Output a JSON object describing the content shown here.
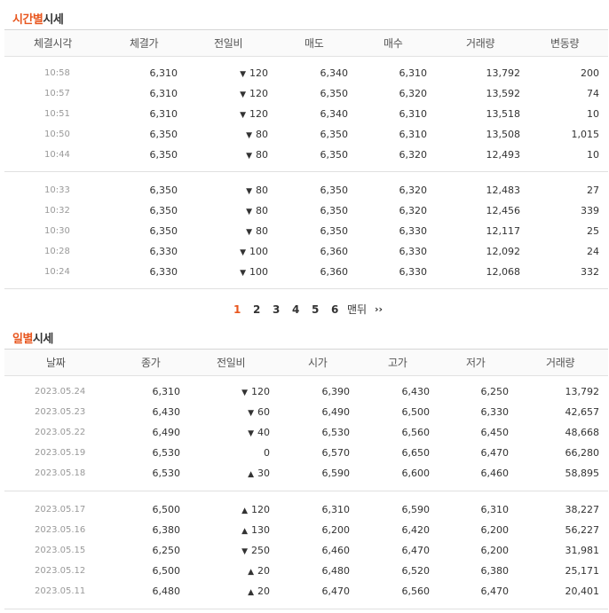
{
  "intraday": {
    "title_highlight": "시간별",
    "title_rest": "시세",
    "headers": [
      "체결시각",
      "체결가",
      "전일비",
      "매도",
      "매수",
      "거래량",
      "변동량"
    ],
    "rows": [
      {
        "time": "10:58",
        "price": "6,310",
        "dir": "down",
        "change": "120",
        "ask": "6,340",
        "bid": "6,310",
        "volume": "13,792",
        "delta": "200"
      },
      {
        "time": "10:57",
        "price": "6,310",
        "dir": "down",
        "change": "120",
        "ask": "6,350",
        "bid": "6,320",
        "volume": "13,592",
        "delta": "74"
      },
      {
        "time": "10:51",
        "price": "6,310",
        "dir": "down",
        "change": "120",
        "ask": "6,340",
        "bid": "6,310",
        "volume": "13,518",
        "delta": "10"
      },
      {
        "time": "10:50",
        "price": "6,350",
        "dir": "down",
        "change": "80",
        "ask": "6,350",
        "bid": "6,310",
        "volume": "13,508",
        "delta": "1,015"
      },
      {
        "time": "10:44",
        "price": "6,350",
        "dir": "down",
        "change": "80",
        "ask": "6,350",
        "bid": "6,320",
        "volume": "12,493",
        "delta": "10"
      },
      {
        "time": "10:33",
        "price": "6,350",
        "dir": "down",
        "change": "80",
        "ask": "6,350",
        "bid": "6,320",
        "volume": "12,483",
        "delta": "27"
      },
      {
        "time": "10:32",
        "price": "6,350",
        "dir": "down",
        "change": "80",
        "ask": "6,350",
        "bid": "6,320",
        "volume": "12,456",
        "delta": "339"
      },
      {
        "time": "10:30",
        "price": "6,350",
        "dir": "down",
        "change": "80",
        "ask": "6,350",
        "bid": "6,330",
        "volume": "12,117",
        "delta": "25"
      },
      {
        "time": "10:28",
        "price": "6,330",
        "dir": "down",
        "change": "100",
        "ask": "6,360",
        "bid": "6,330",
        "volume": "12,092",
        "delta": "24"
      },
      {
        "time": "10:24",
        "price": "6,330",
        "dir": "down",
        "change": "100",
        "ask": "6,360",
        "bid": "6,330",
        "volume": "12,068",
        "delta": "332"
      }
    ]
  },
  "pagination": {
    "pages": [
      "1",
      "2",
      "3",
      "4",
      "5",
      "6"
    ],
    "current": "1",
    "last_label": "맨뒤",
    "next_label": "››"
  },
  "daily": {
    "title_highlight": "일별",
    "title_rest": "시세",
    "headers": [
      "날짜",
      "종가",
      "전일비",
      "시가",
      "고가",
      "저가",
      "거래량"
    ],
    "rows": [
      {
        "date": "2023.05.24",
        "close": "6,310",
        "dir": "down",
        "change": "120",
        "open": "6,390",
        "high": "6,430",
        "low": "6,250",
        "volume": "13,792"
      },
      {
        "date": "2023.05.23",
        "close": "6,430",
        "dir": "down",
        "change": "60",
        "open": "6,490",
        "high": "6,500",
        "low": "6,330",
        "volume": "42,657"
      },
      {
        "date": "2023.05.22",
        "close": "6,490",
        "dir": "down",
        "change": "40",
        "open": "6,530",
        "high": "6,560",
        "low": "6,450",
        "volume": "48,668"
      },
      {
        "date": "2023.05.19",
        "close": "6,530",
        "dir": "none",
        "change": "0",
        "open": "6,570",
        "high": "6,650",
        "low": "6,470",
        "volume": "66,280"
      },
      {
        "date": "2023.05.18",
        "close": "6,530",
        "dir": "up",
        "change": "30",
        "open": "6,590",
        "high": "6,600",
        "low": "6,460",
        "volume": "58,895"
      },
      {
        "date": "2023.05.17",
        "close": "6,500",
        "dir": "up",
        "change": "120",
        "open": "6,310",
        "high": "6,590",
        "low": "6,310",
        "volume": "38,227"
      },
      {
        "date": "2023.05.16",
        "close": "6,380",
        "dir": "up",
        "change": "130",
        "open": "6,200",
        "high": "6,420",
        "low": "6,200",
        "volume": "56,227"
      },
      {
        "date": "2023.05.15",
        "close": "6,250",
        "dir": "down",
        "change": "250",
        "open": "6,460",
        "high": "6,470",
        "low": "6,200",
        "volume": "31,981"
      },
      {
        "date": "2023.05.12",
        "close": "6,500",
        "dir": "up",
        "change": "20",
        "open": "6,480",
        "high": "6,520",
        "low": "6,380",
        "volume": "25,171"
      },
      {
        "date": "2023.05.11",
        "close": "6,480",
        "dir": "up",
        "change": "20",
        "open": "6,470",
        "high": "6,560",
        "low": "6,470",
        "volume": "20,401"
      }
    ]
  },
  "colors": {
    "accent": "#e8561e",
    "down": "#1a5fc4",
    "up": "#d91a1a"
  },
  "icons": {
    "down": "triangle-down-icon",
    "up": "triangle-up-icon"
  }
}
